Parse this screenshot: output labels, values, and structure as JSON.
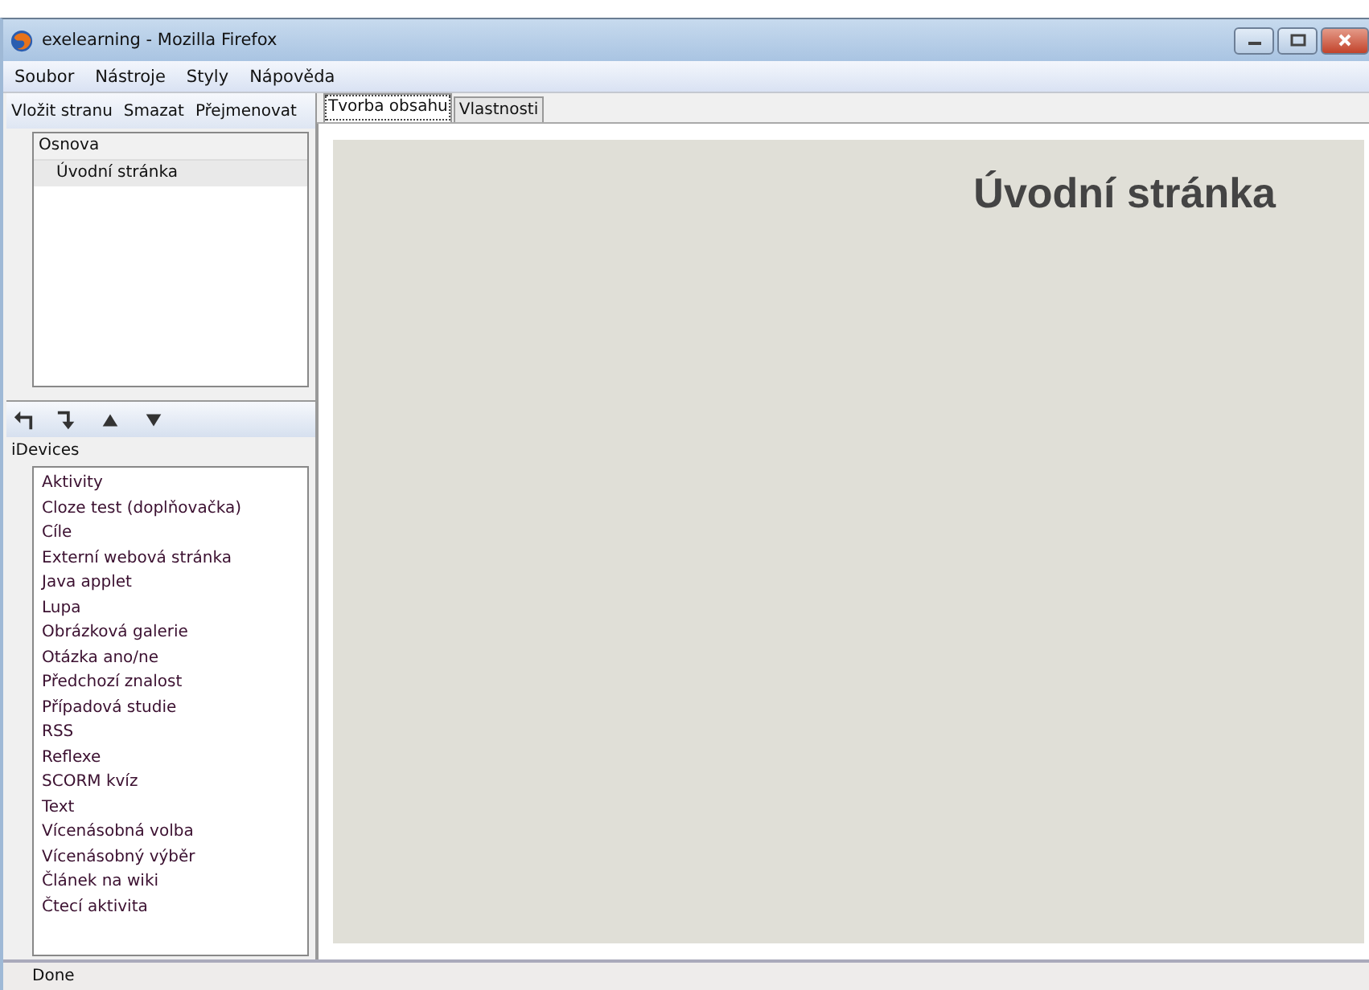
{
  "window": {
    "title": "exelearning - Mozilla Firefox"
  },
  "menu": [
    "Soubor",
    "Nástroje",
    "Styly",
    "Nápověda"
  ],
  "outline_toolbar": [
    "Vložit stranu",
    "Smazat",
    "Přejmenovat"
  ],
  "outline": {
    "header": "Osnova",
    "items": [
      {
        "label": "Úvodní stránka",
        "selected": true
      }
    ]
  },
  "idevices": {
    "label": "iDevices",
    "items": [
      "Aktivity",
      "Cloze test (doplňovačka)",
      "Cíle",
      "Externí webová stránka",
      "Java applet",
      "Lupa",
      "Obrázková galerie",
      "Otázka ano/ne",
      "Předchozí znalost",
      "Případová studie",
      "RSS",
      "Reflexe",
      "SCORM kvíz",
      "Text",
      "Vícenásobná volba",
      "Vícenásobný výběr",
      "Článek na wiki",
      "Čtecí aktivita"
    ]
  },
  "tabs": [
    {
      "label": "Tvorba obsahu",
      "selected": true
    },
    {
      "label": "Vlastnosti",
      "selected": false
    }
  ],
  "page": {
    "title": "Úvodní stránka"
  },
  "status_bar": "Done"
}
